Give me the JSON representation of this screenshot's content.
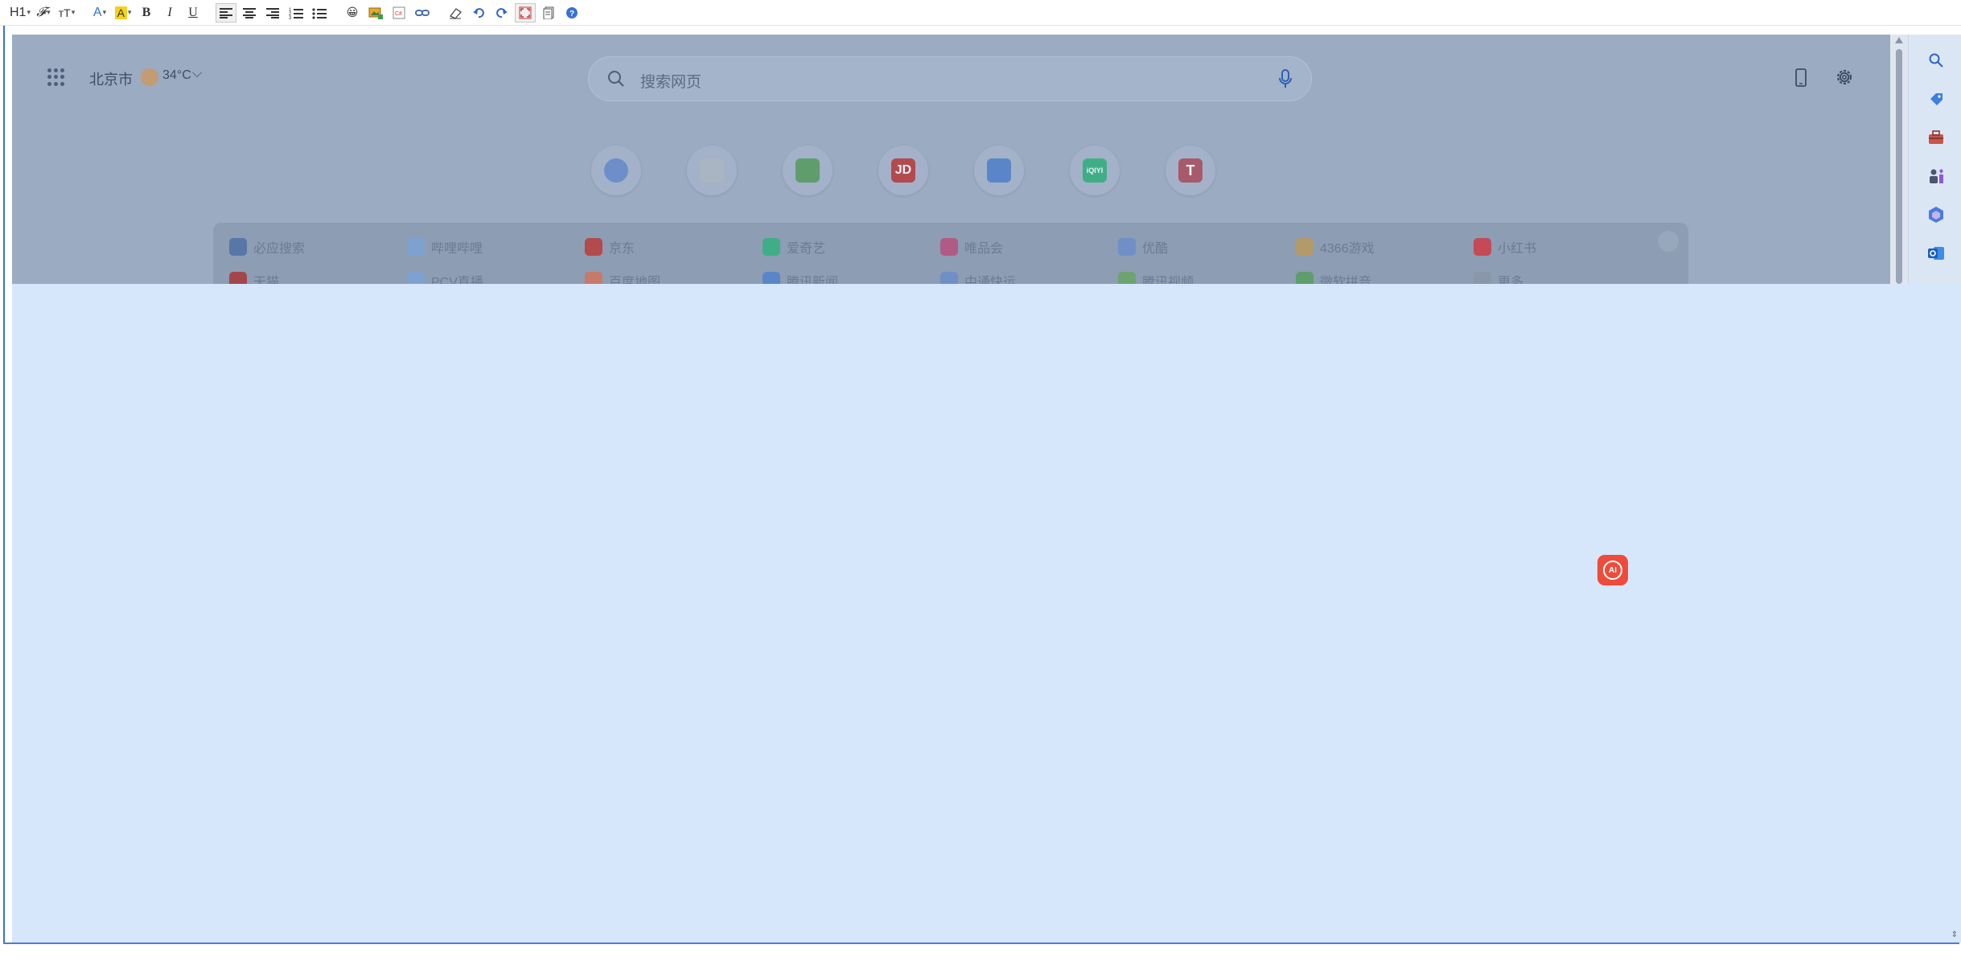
{
  "toolbar": {
    "heading": "H1",
    "font_family_icon": "𝓕",
    "font_size": "тT",
    "font_color": "A",
    "highlight": "A",
    "bold": "B",
    "italic": "I",
    "underline": "U",
    "emoji": "😀"
  },
  "browser": {
    "city": "北京市",
    "temperature": "34°C",
    "search_placeholder": "搜索网页",
    "shortcuts": [
      {
        "icon": "ai-assistant-icon",
        "label": "",
        "color": "#6d8ec9"
      },
      {
        "icon": "app-store-icon",
        "label": "",
        "color": "#aab5c4"
      },
      {
        "icon": "pinwheel-icon",
        "label": "",
        "color": "#5f9d6c"
      },
      {
        "icon": "jd-icon",
        "label": "JD",
        "color": "#b24a4e"
      },
      {
        "icon": "refresh-app-icon",
        "label": "",
        "color": "#5a86c9"
      },
      {
        "icon": "iqiyi-icon",
        "label": "iQIYI",
        "color": "#3fae87"
      },
      {
        "icon": "taobao-t-icon",
        "label": "T",
        "color": "#a65a6c"
      }
    ],
    "links_row1": [
      {
        "label": "必应搜索",
        "color": "#5876a7"
      },
      {
        "label": "哔哩哔哩",
        "color": "#7ea2cf"
      },
      {
        "label": "京东",
        "color": "#b24a4e"
      },
      {
        "label": "爱奇艺",
        "color": "#3fae87"
      },
      {
        "label": "唯品会",
        "color": "#b05a86"
      },
      {
        "label": "优酷",
        "color": "#6f8fc6"
      },
      {
        "label": "4366游戏",
        "color": "#b39a6a"
      },
      {
        "label": "小红书",
        "color": "#c44a58"
      }
    ],
    "links_row2": [
      {
        "label": "天猫",
        "color": "#a3464c"
      },
      {
        "label": "PCV直播",
        "color": "#7ea2cf"
      },
      {
        "label": "百度地图",
        "color": "#c77a6a"
      },
      {
        "label": "腾讯新闻",
        "color": "#5a86c9"
      },
      {
        "label": "中通快运",
        "color": "#6f8fc6"
      },
      {
        "label": "腾讯视频",
        "color": "#6ea36f"
      },
      {
        "label": "微软拼音",
        "color": "#5f9d6c"
      },
      {
        "label": "更多",
        "color": "#8a97aa"
      }
    ]
  },
  "sidepanel": {
    "icons": [
      "search-icon",
      "tag-icon",
      "toolbox-icon",
      "chess-icon",
      "copilot-icon",
      "outlook-icon"
    ]
  },
  "ai_button": {
    "label": "AI",
    "color": "#ee4b3b"
  }
}
